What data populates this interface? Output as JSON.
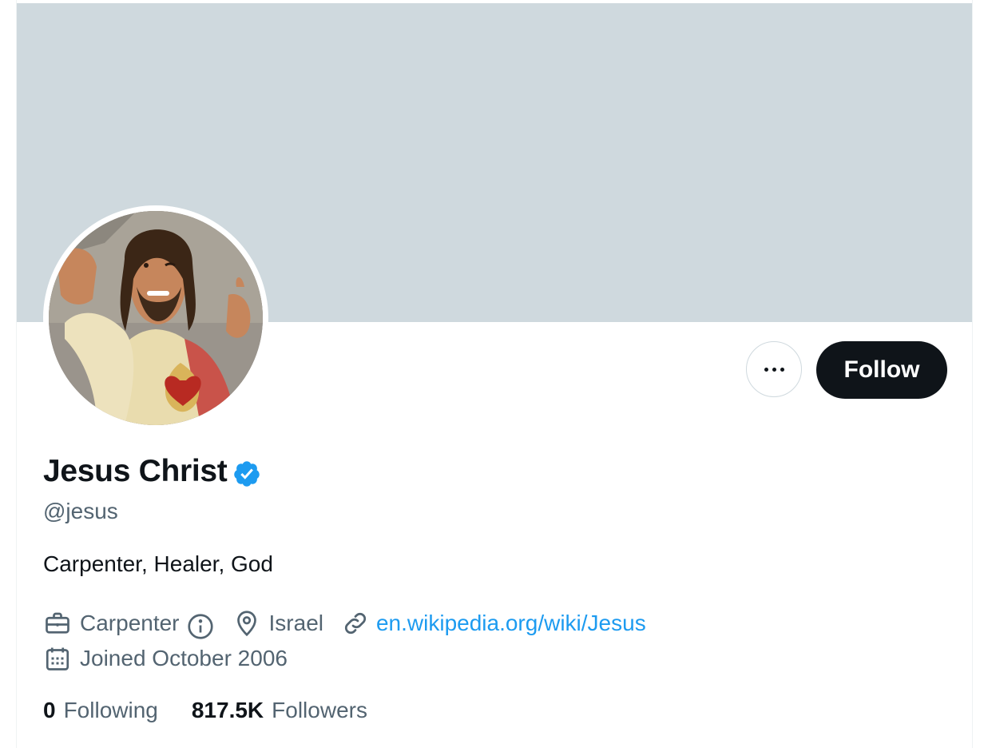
{
  "profile": {
    "display_name": "Jesus Christ",
    "handle": "@jesus",
    "bio": "Carpenter, Healer, God",
    "verified": true
  },
  "actions": {
    "follow_label": "Follow",
    "more_icon": "ellipsis-icon"
  },
  "meta": {
    "profession": "Carpenter",
    "location": "Israel",
    "website": "en.wikipedia.org/wiki/Jesus",
    "joined": "Joined October 2006"
  },
  "stats": {
    "following_count": "0",
    "following_label": "Following",
    "followers_count": "817.5K",
    "followers_label": "Followers"
  },
  "colors": {
    "banner": "#cfd9de",
    "accent": "#1d9bf0",
    "primary_text": "#0f1419",
    "secondary_text": "#536471",
    "follow_button": "#0f1419"
  },
  "icons": {
    "profession": "briefcase-icon",
    "info": "info-icon",
    "location": "location-pin-icon",
    "website": "link-icon",
    "joined": "calendar-icon",
    "verified": "verified-badge-icon"
  }
}
